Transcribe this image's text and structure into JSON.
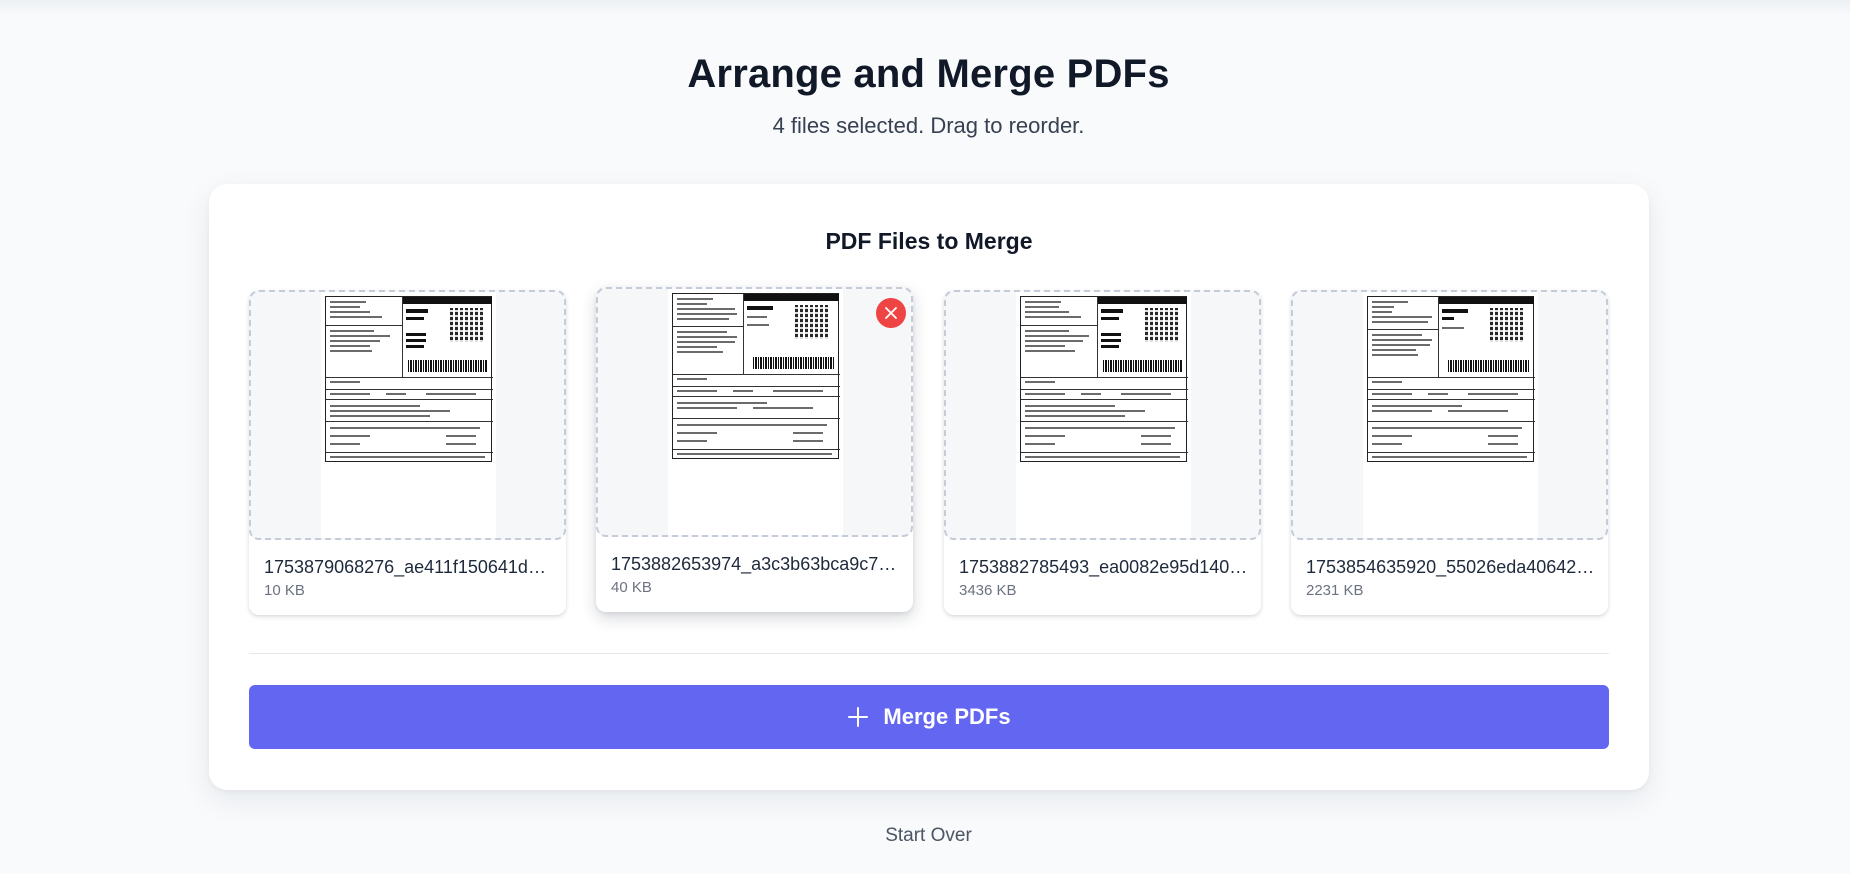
{
  "page": {
    "title": "Arrange and Merge PDFs",
    "subtitle": "4 files selected. Drag to reorder."
  },
  "panel": {
    "title": "PDF Files to Merge"
  },
  "files": [
    {
      "name": "1753879068276_ae411f150641d52c...",
      "size": "10 KB"
    },
    {
      "name": "1753882653974_a3c3b63bca9c76d...",
      "size": "40 KB"
    },
    {
      "name": "1753882785493_ea0082e95d1408...",
      "size": "3436 KB"
    },
    {
      "name": "1753854635920_55026eda40642ff...",
      "size": "2231 KB"
    }
  ],
  "actions": {
    "merge_label": "Merge PDFs",
    "start_over_label": "Start Over"
  },
  "icons": {
    "remove": "close-icon",
    "merge": "plus-icon"
  },
  "colors": {
    "accent": "#6366f1",
    "remove": "#ef4444",
    "background": "#f8fafc"
  }
}
